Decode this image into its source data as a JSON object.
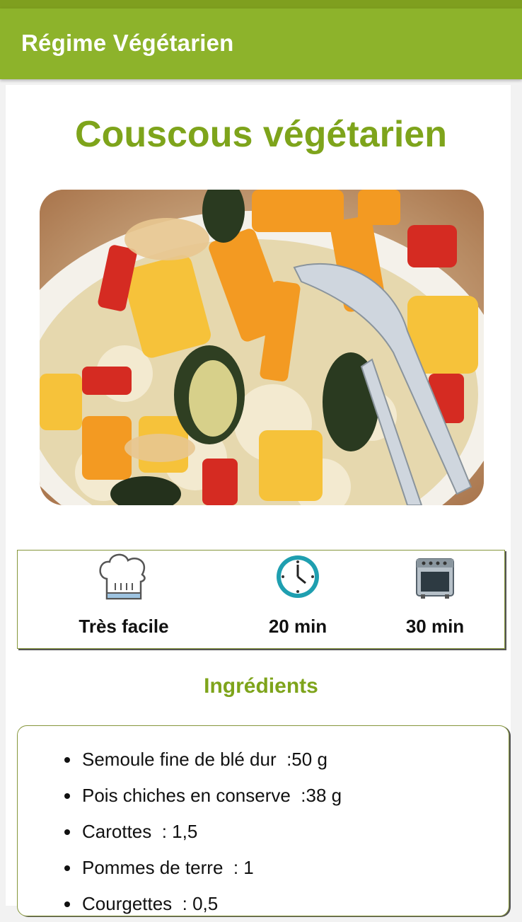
{
  "app": {
    "title": "Régime Végétarien"
  },
  "recipe": {
    "title": "Couscous végétarien",
    "image_alt": "Couscous with vegetables",
    "difficulty": "Très facile",
    "prep_time": "20 min",
    "cook_time": "30 min",
    "icons": [
      "chef-hat-icon",
      "clock-icon",
      "oven-icon"
    ]
  },
  "ingredients": {
    "heading": "Ingrédients",
    "items": [
      "Semoule fine de blé dur  :50 g",
      "Pois chiches en conserve  :38 g",
      "Carottes  : 1,5",
      "Pommes de terre  : 1",
      "Courgettes  : 0,5"
    ]
  },
  "colors": {
    "app_bar": "#8db32b",
    "accent_text": "#7ea41b",
    "box_border": "#86963b"
  }
}
